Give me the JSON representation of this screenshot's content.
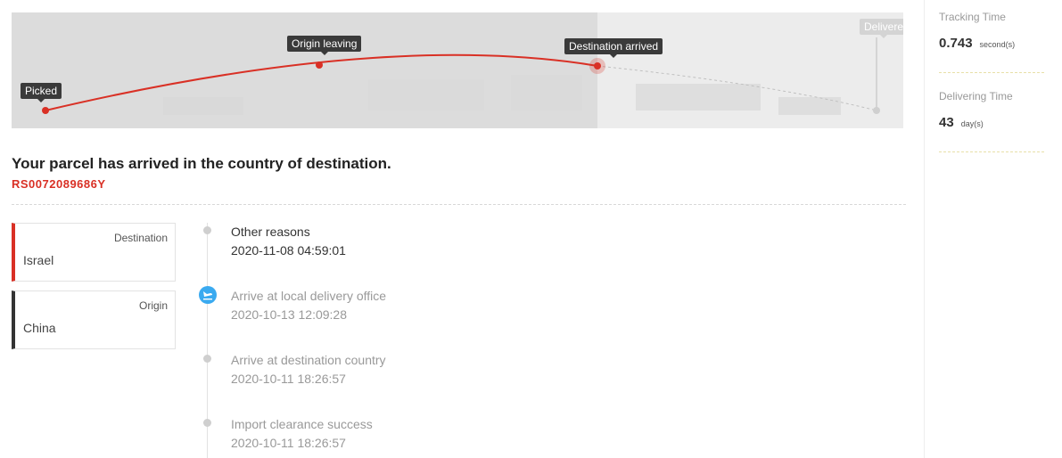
{
  "map": {
    "milestones": [
      {
        "label": "Picked",
        "state": "done"
      },
      {
        "label": "Origin leaving",
        "state": "done"
      },
      {
        "label": "Destination arrived",
        "state": "current"
      },
      {
        "label": "Delivere",
        "state": "pending"
      }
    ],
    "colors": {
      "route": "#d93025",
      "pending": "#d4d4d4"
    }
  },
  "summary": {
    "status_title": "Your parcel has arrived in the country of destination.",
    "tracking_number": "RS0072089686Y"
  },
  "countries": {
    "destination": {
      "label": "Destination",
      "value": "Israel"
    },
    "origin": {
      "label": "Origin",
      "value": "China"
    }
  },
  "events": [
    {
      "status": "Other reasons",
      "time": "2020-11-08 04:59:01",
      "icon": "dot"
    },
    {
      "status": "Arrive at local delivery office",
      "time": "2020-10-13 12:09:28",
      "icon": "plane-landing-icon"
    },
    {
      "status": "Arrive at destination country",
      "time": "2020-10-11 18:26:57",
      "icon": "dot"
    },
    {
      "status": "Import clearance success",
      "time": "2020-10-11 18:26:57",
      "icon": "dot"
    }
  ],
  "stats": {
    "tracking_time": {
      "label": "Tracking Time",
      "value": "0.743",
      "unit": "second(s)"
    },
    "delivering_time": {
      "label": "Delivering Time",
      "value": "43",
      "unit": "day(s)"
    }
  }
}
